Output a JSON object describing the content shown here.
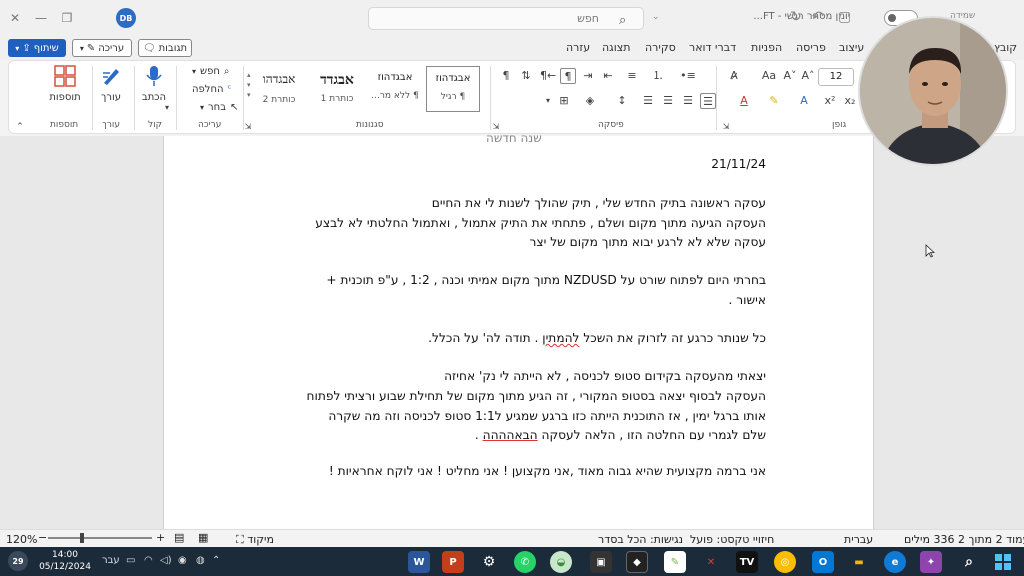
{
  "titlebar": {
    "avatar_initials": "DB",
    "search_placeholder": "חפש",
    "doc_title": "יומן מסחר רגשי - FT...",
    "user_name": "שמידה"
  },
  "tabs_row": {
    "share_label": "שיתוף",
    "edit_label": "עריכה",
    "comments_label": "תגובות",
    "tabs": [
      "קובץ",
      "עיצוב",
      "פריסה",
      "הפניות",
      "דברי דואר",
      "סקירה",
      "תצוגה",
      "עזרה"
    ]
  },
  "ribbon": {
    "addins": {
      "label": "תוספות",
      "group": "תוספות"
    },
    "editor": {
      "label": "עורך",
      "group": "עורך"
    },
    "voice": {
      "label": "הכתב",
      "group": "קול"
    },
    "editing": {
      "find": "חפש",
      "replace": "החלפה",
      "select": "בחר",
      "group": "עריכה"
    },
    "styles": {
      "group": "סגנונות",
      "cards": [
        {
          "sample": "אבגדהוז",
          "name": "¶ רגיל"
        },
        {
          "sample": "אבגדהוז",
          "name": "¶ ללא מר..."
        },
        {
          "sample": "אבגדד",
          "name": "כותרת 1"
        },
        {
          "sample": "אבגדהו",
          "name": "כותרת 2"
        }
      ]
    },
    "paragraph_group": "פיסקה",
    "font_group": "גופן",
    "font_size": "12"
  },
  "document": {
    "heading": "שנה חדשה",
    "date": "21/11/24",
    "lines": [
      "עסקה ראשונה בתיק החדש שלי , תיק שהולך לשנות לי את החיים",
      "העסקה הגיעה מתוך מקום ושלם , פתחתי את התיק אתמול , ואתמול החלטתי לא לבצע",
      "עסקה שלא לא לרגע יבוא מתוך מקום של יצר",
      "בחרתי היום לפתוח שורט על NZDUSD מתוך מקום אמיתי וכנה , 1:2 , ע\"פ תוכנית +",
      "אישור .",
      "כל שנותר כרגע זה לזרוק את השכל ",
      "להמתין",
      " . תודה לה' על הכלל.",
      "יצאתי מהעסקה בקידום סטופ לכניסה , לא הייתה לי נק' אחיזה",
      "העסקה לבסוף יצאה בסטופ המקורי , זה הגיע מתוך מקום של תחילת שבוע ורציתי לפתוח",
      "אותו ברגל ימין , אז התוכנית הייתה כזו ברגע שמגיע ל1:1 סטופ לכניסה וזה מה שקרה",
      "שלם לגמרי עם החלטה הזו , הלאה לעסקה ",
      "הבאהההה",
      " .",
      "אני ברמה מקצועית שהיא גבוה מאוד ,אני מקצוען ! אני מחליט ! אני לוקח אחראיות !"
    ]
  },
  "statusbar": {
    "page": "עמוד 2 מתוך 2",
    "words": "336 מילים",
    "language": "עברית",
    "text_predictions": "חיזויי טקסט: פועל",
    "accessibility": "נגישות: הכל בסדר",
    "focus": "מיקוד",
    "zoom": "120%"
  },
  "taskbar": {
    "time": "14:00",
    "date": "05/12/2024",
    "lang": "עבר",
    "notif_count": "29"
  }
}
